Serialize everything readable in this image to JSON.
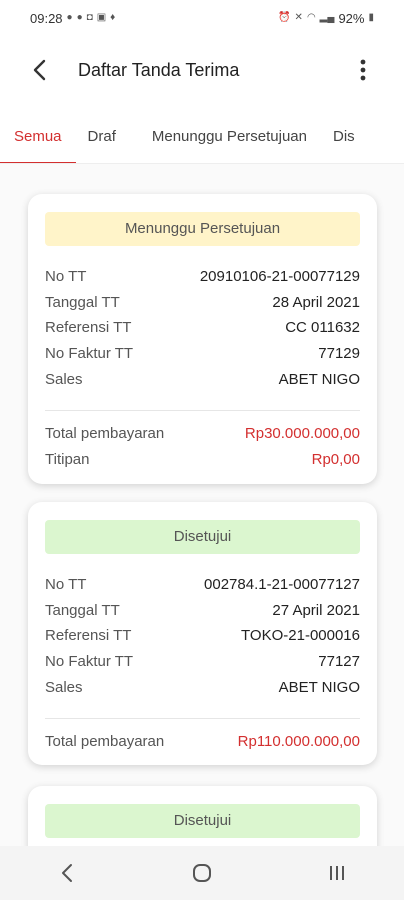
{
  "status_bar": {
    "time": "09:28",
    "battery": "92%"
  },
  "app_bar": {
    "title": "Daftar Tanda Terima"
  },
  "tabs": [
    {
      "label": "Semua",
      "active": true
    },
    {
      "label": "Draf",
      "active": false
    },
    {
      "label": "Menunggu Persetujuan",
      "active": false
    },
    {
      "label": "Dis",
      "active": false
    }
  ],
  "cards": [
    {
      "status": "Menunggu Persetujuan",
      "fields": [
        {
          "label": "No TT",
          "value": "20910106-21-00077129"
        },
        {
          "label": "Tanggal TT",
          "value": "28 April 2021"
        },
        {
          "label": "Referensi TT",
          "value": "CC 011632"
        },
        {
          "label": "No Faktur TT",
          "value": "77129"
        },
        {
          "label": "Sales",
          "value": "ABET NIGO"
        }
      ],
      "totals": [
        {
          "label": "Total pembayaran",
          "value": "Rp30.000.000,00"
        },
        {
          "label": "Titipan",
          "value": "Rp0,00"
        }
      ]
    },
    {
      "status": "Disetujui",
      "fields": [
        {
          "label": "No TT",
          "value": "002784.1-21-00077127"
        },
        {
          "label": "Tanggal TT",
          "value": "27 April 2021"
        },
        {
          "label": "Referensi TT",
          "value": "TOKO-21-000016"
        },
        {
          "label": "No Faktur TT",
          "value": "77127"
        },
        {
          "label": "Sales",
          "value": "ABET NIGO"
        }
      ],
      "totals": [
        {
          "label": "Total pembayaran",
          "value": "Rp110.000.000,00"
        }
      ]
    },
    {
      "status": "Disetujui"
    }
  ],
  "colors": {
    "accent": "#d32f2f",
    "waiting_bg": "#fff4c9",
    "approved_bg": "#dbf6cf"
  }
}
